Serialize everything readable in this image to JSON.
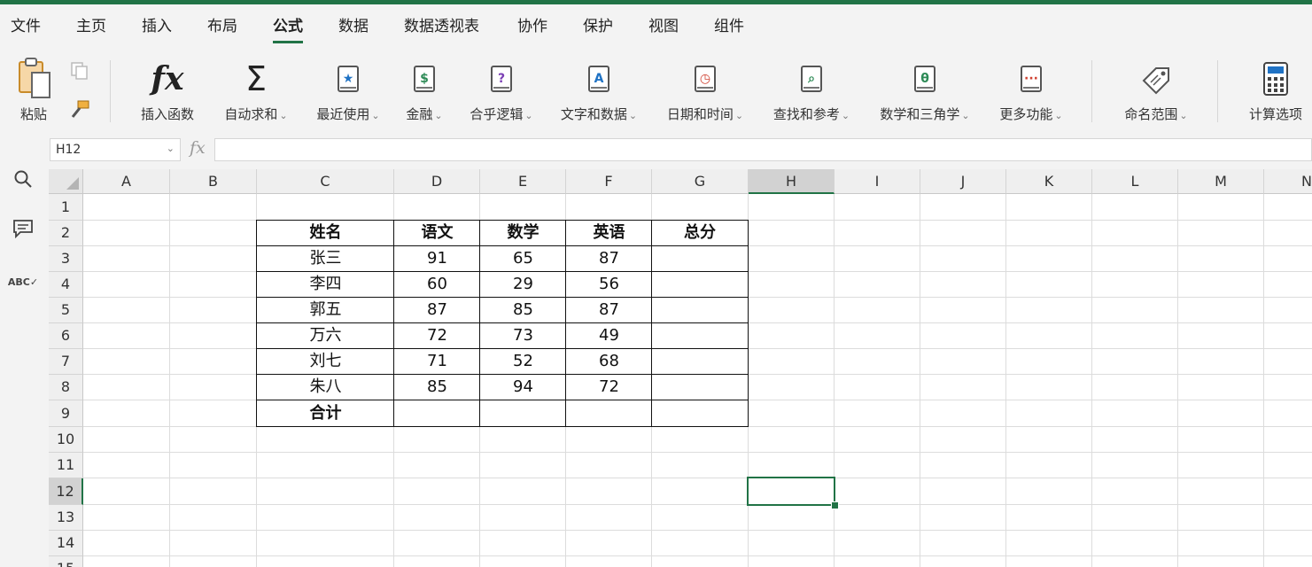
{
  "menu": {
    "items": [
      "文件",
      "主页",
      "插入",
      "布局",
      "公式",
      "数据",
      "数据透视表",
      "协作",
      "保护",
      "视图",
      "组件"
    ],
    "active_index": 4
  },
  "ribbon": {
    "paste_label": "粘贴",
    "insert_function": "插入函数",
    "autosum": "自动求和",
    "recent": "最近使用",
    "financial": "金融",
    "logical": "合乎逻辑",
    "text": "文字和数据",
    "datetime": "日期和时间",
    "lookup": "查找和参考",
    "math": "数学和三角学",
    "more": "更多功能",
    "name_range": "命名范围",
    "calc_options": "计算选项"
  },
  "formula_bar": {
    "name_box": "H12",
    "fx": "fx",
    "value": ""
  },
  "sheet": {
    "columns": [
      "A",
      "B",
      "C",
      "D",
      "E",
      "F",
      "G",
      "H",
      "I",
      "J",
      "K",
      "L",
      "M",
      "N"
    ],
    "rows": [
      "1",
      "2",
      "3",
      "4",
      "5",
      "6",
      "7",
      "8",
      "9",
      "10",
      "11",
      "12",
      "13",
      "14",
      "15"
    ],
    "selected_cell": "H12",
    "table": {
      "headers": [
        "姓名",
        "语文",
        "数学",
        "英语",
        "总分"
      ],
      "rows": [
        [
          "张三",
          "91",
          "65",
          "87",
          ""
        ],
        [
          "李四",
          "60",
          "29",
          "56",
          ""
        ],
        [
          "郭五",
          "87",
          "85",
          "87",
          ""
        ],
        [
          "万六",
          "72",
          "73",
          "49",
          ""
        ],
        [
          "刘七",
          "71",
          "52",
          "68",
          ""
        ],
        [
          "朱八",
          "85",
          "94",
          "72",
          ""
        ]
      ],
      "total_label": "合计"
    }
  },
  "colors": {
    "accent": "#217346"
  }
}
